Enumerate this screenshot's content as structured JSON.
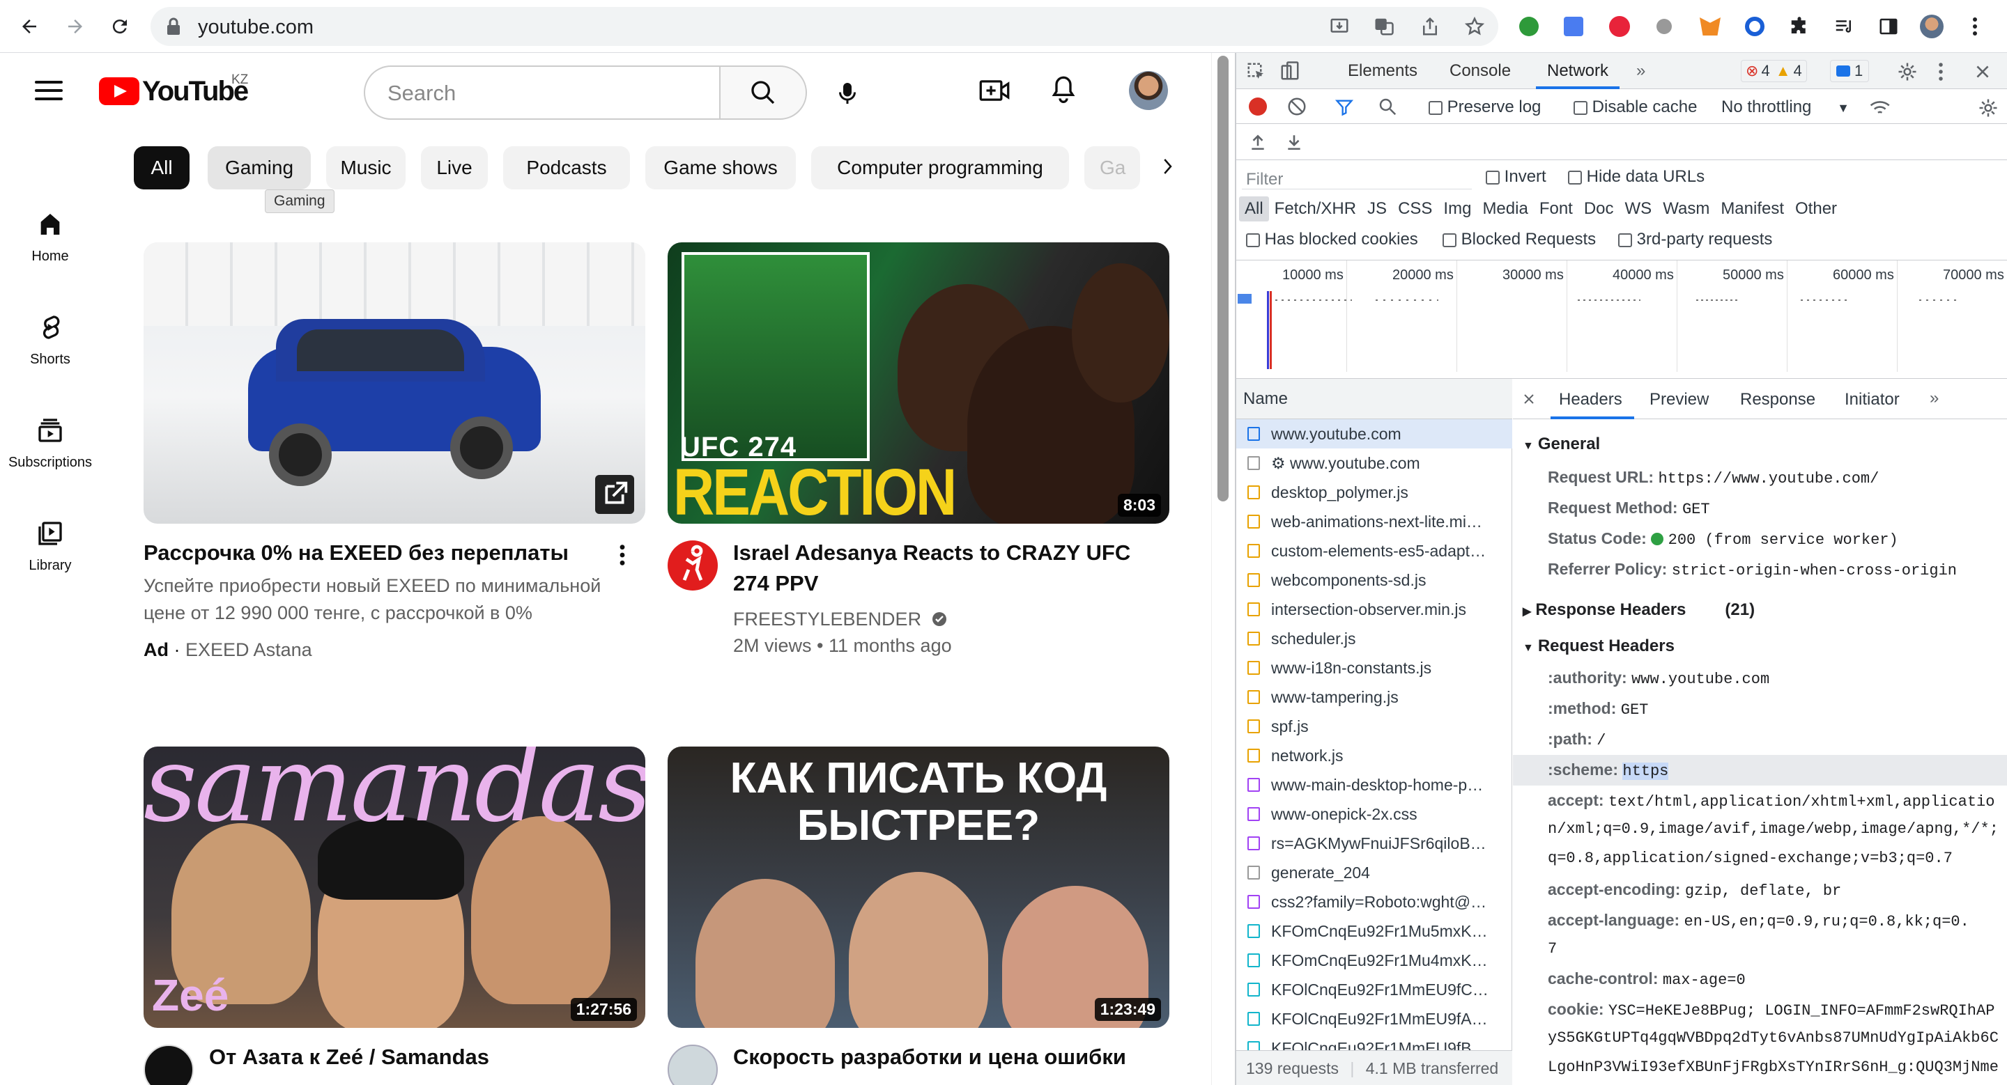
{
  "browser": {
    "url": "youtube.com"
  },
  "youtube": {
    "logo_text": "YouTube",
    "region": "KZ",
    "search_placeholder": "Search",
    "sidebar": [
      {
        "label": "Home"
      },
      {
        "label": "Shorts"
      },
      {
        "label": "Subscriptions"
      },
      {
        "label": "Library"
      }
    ],
    "chips": [
      "All",
      "Gaming",
      "Music",
      "Live",
      "Podcasts",
      "Game shows",
      "Computer programming",
      "Ga"
    ],
    "tooltip": "Gaming",
    "videos": [
      {
        "title": "Рассрочка 0% на EXEED без переплаты",
        "desc_line1": "Успейте приобрести новый EXEED по минимальной",
        "desc_line2": "цене от 12 990 000 тенге, с рассрочкой в 0%",
        "ad_label": "Ad",
        "channel": "EXEED Astana"
      },
      {
        "title_line1": "Israel Adesanya Reacts to CRAZY UFC",
        "title_line2": "274 PPV",
        "channel": "FREESTYLEBENDER",
        "meta": "2M views • 11 months ago",
        "duration": "8:03",
        "thumb_text1": "UFC 274",
        "thumb_text2": "REACTION"
      },
      {
        "title": "От Азата к Zeé / Samandas",
        "duration": "1:27:56",
        "thumb_text": "samandas",
        "thumb_tag": "Zeé"
      },
      {
        "title": "Скорость разработки и цена ошибки",
        "duration": "1:23:49",
        "thumb_text1": "КАК ПИСАТЬ КОД",
        "thumb_text2": "БЫСТРЕЕ?"
      }
    ]
  },
  "devtools": {
    "tabs": [
      "Elements",
      "Console",
      "Network"
    ],
    "errors": "4",
    "warnings": "4",
    "messages": "1",
    "toolbar": {
      "preserve_log": "Preserve log",
      "disable_cache": "Disable cache",
      "throttling": "No throttling"
    },
    "filter": {
      "placeholder": "Filter",
      "invert": "Invert",
      "hide_data_urls": "Hide data URLs",
      "types": [
        "All",
        "Fetch/XHR",
        "JS",
        "CSS",
        "Img",
        "Media",
        "Font",
        "Doc",
        "WS",
        "Wasm",
        "Manifest",
        "Other"
      ],
      "has_blocked_cookies": "Has blocked cookies",
      "blocked_requests": "Blocked Requests",
      "third_party": "3rd-party requests"
    },
    "timeline_labels": [
      "10000 ms",
      "20000 ms",
      "30000 ms",
      "40000 ms",
      "50000 ms",
      "60000 ms",
      "70000 ms"
    ],
    "name_header": "Name",
    "requests": [
      {
        "name": "www.youtube.com",
        "type": "doc"
      },
      {
        "name": "⚙ www.youtube.com",
        "type": "blank"
      },
      {
        "name": "desktop_polymer.js",
        "type": "js"
      },
      {
        "name": "web-animations-next-lite.mi…",
        "type": "js"
      },
      {
        "name": "custom-elements-es5-adapt…",
        "type": "js"
      },
      {
        "name": "webcomponents-sd.js",
        "type": "js"
      },
      {
        "name": "intersection-observer.min.js",
        "type": "js"
      },
      {
        "name": "scheduler.js",
        "type": "js"
      },
      {
        "name": "www-i18n-constants.js",
        "type": "js"
      },
      {
        "name": "www-tampering.js",
        "type": "js"
      },
      {
        "name": "spf.js",
        "type": "js"
      },
      {
        "name": "network.js",
        "type": "js"
      },
      {
        "name": "www-main-desktop-home-p…",
        "type": "css"
      },
      {
        "name": "www-onepick-2x.css",
        "type": "css"
      },
      {
        "name": "rs=AGKMywFnuiJFSr6qiloB…",
        "type": "css"
      },
      {
        "name": "generate_204",
        "type": "blank"
      },
      {
        "name": "css2?family=Roboto:wght@…",
        "type": "css"
      },
      {
        "name": "KFOmCnqEu92Fr1Mu5mxK…",
        "type": "font"
      },
      {
        "name": "KFOmCnqEu92Fr1Mu4mxK…",
        "type": "font"
      },
      {
        "name": "KFOlCnqEu92Fr1MmEU9fC…",
        "type": "font"
      },
      {
        "name": "KFOlCnqEu92Fr1MmEU9fA…",
        "type": "font"
      },
      {
        "name": "KFOlCnqEu92Fr1MmEU9fB…",
        "type": "font"
      }
    ],
    "footer": {
      "requests": "139 requests",
      "transferred": "4.1 MB transferred"
    },
    "headers_tabs": [
      "Headers",
      "Preview",
      "Response",
      "Initiator"
    ],
    "general": {
      "title": "General",
      "request_url_k": "Request URL:",
      "request_url_v": "https://www.youtube.com/",
      "method_k": "Request Method:",
      "method_v": "GET",
      "status_k": "Status Code:",
      "status_v": "200  (from service worker)",
      "referrer_k": "Referrer Policy:",
      "referrer_v": "strict-origin-when-cross-origin"
    },
    "response_headers": {
      "title": "Response Headers",
      "count": "(21)"
    },
    "request_headers": {
      "title": "Request Headers",
      "authority_k": ":authority:",
      "authority_v": "www.youtube.com",
      "method_k": ":method:",
      "method_v": "GET",
      "path_k": ":path:",
      "path_v": "/",
      "scheme_k": ":scheme:",
      "scheme_v": "https",
      "accept_k": "accept:",
      "accept_v1": "text/html,application/xhtml+xml,applicatio",
      "accept_v2": "n/xml;q=0.9,image/avif,image/webp,image/apng,*/*;",
      "accept_v3": "q=0.8,application/signed-exchange;v=b3;q=0.7",
      "encoding_k": "accept-encoding:",
      "encoding_v": "gzip, deflate, br",
      "language_k": "accept-language:",
      "language_v1": "en-US,en;q=0.9,ru;q=0.8,kk;q=0.",
      "language_v2": "7",
      "cache_k": "cache-control:",
      "cache_v": "max-age=0",
      "cookie_k": "cookie:",
      "cookie_v1": "YSC=HeKEJe8BPug; LOGIN_INFO=AFmmF2swRQIhAP",
      "cookie_v2": "yS5GKGtUPTq4gqWVBDpq2dTyt6vAnbs87UMnUdYgIpAiAkb6C",
      "cookie_v3": "LgoHnP3VWiI93efXBUnFjFRgbXsTYnIRrS6nH_g:QUQ3MjNme"
    }
  }
}
